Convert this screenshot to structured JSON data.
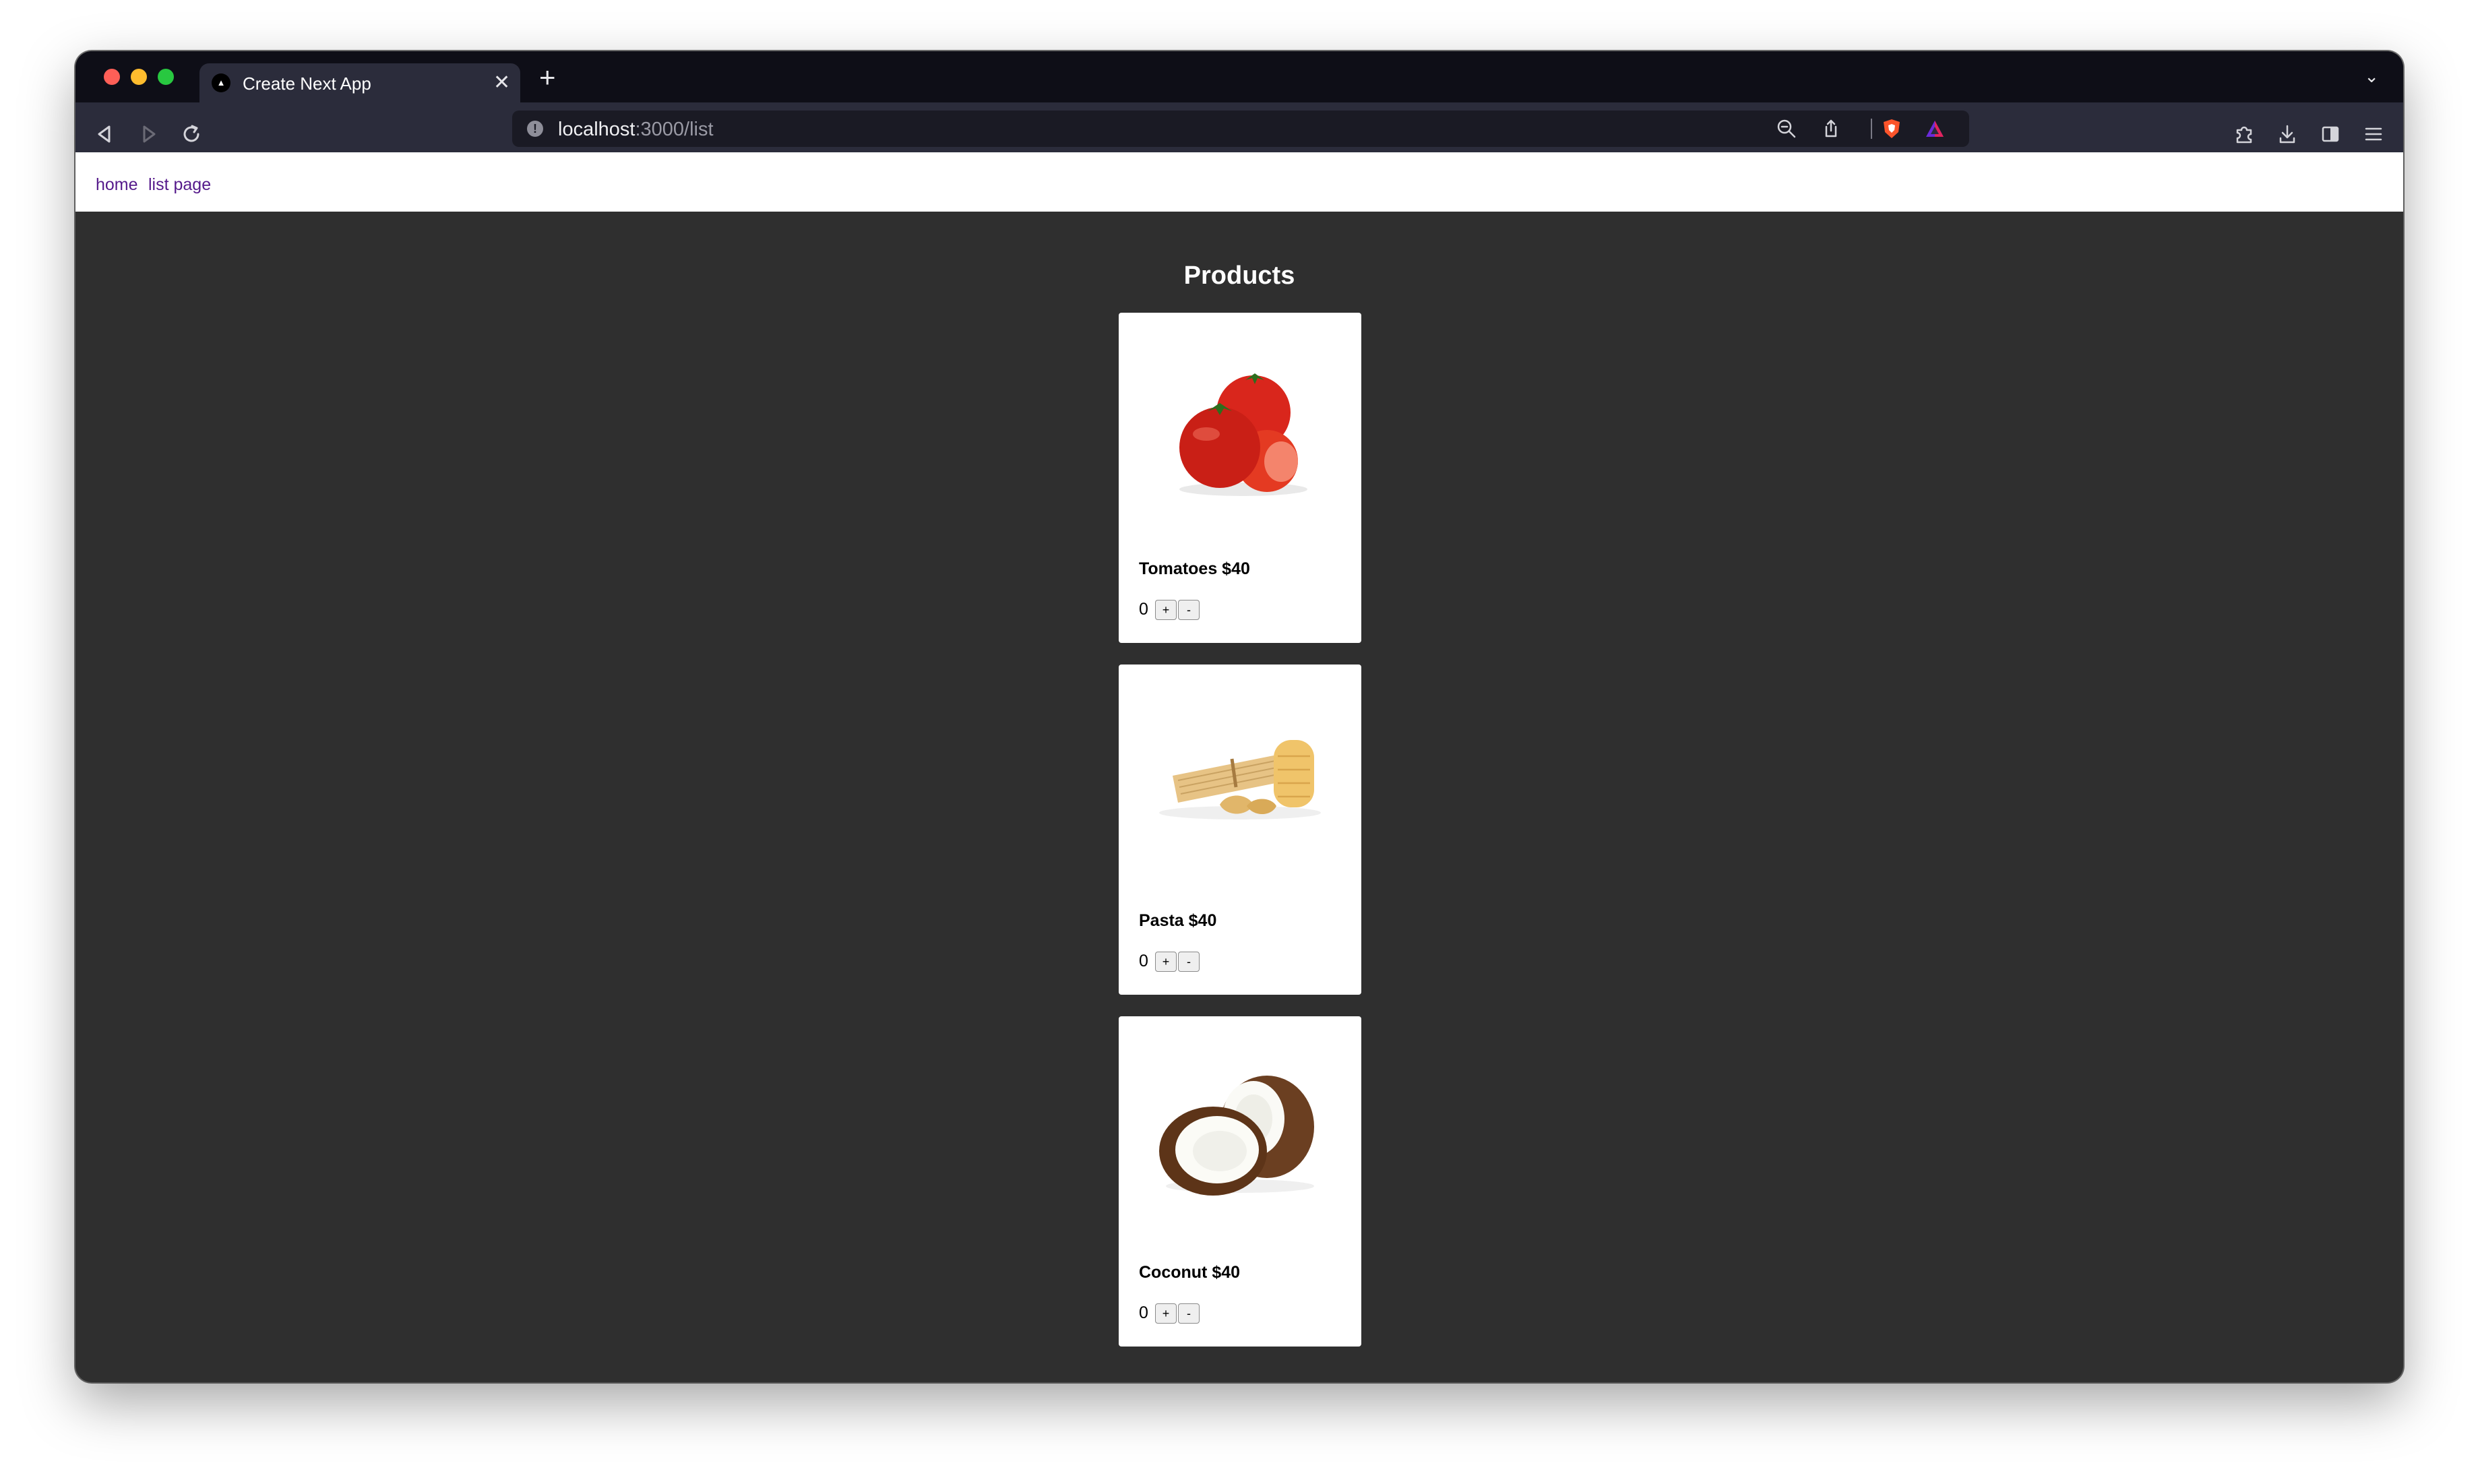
{
  "browser": {
    "tab": {
      "title": "Create Next App",
      "favicon": "next-logo-icon",
      "close": "✕"
    },
    "new_tab": "+",
    "tab_menu": "⌄",
    "url": {
      "host": "localhost",
      "path": ":3000/list"
    }
  },
  "nav": {
    "home": "home",
    "list_page": "list page"
  },
  "page": {
    "heading": "Products"
  },
  "products": [
    {
      "title": "Tomatoes $40",
      "quantity": "0",
      "plus": "+",
      "minus": "-",
      "image": "tomatoes"
    },
    {
      "title": "Pasta $40",
      "quantity": "0",
      "plus": "+",
      "minus": "-",
      "image": "pasta"
    },
    {
      "title": "Coconut $40",
      "quantity": "0",
      "plus": "+",
      "minus": "-",
      "image": "coconut"
    }
  ],
  "colors": {
    "page_background": "#2f2f2f",
    "titlebar": "#0e0e17",
    "toolbar": "#2b2c3b",
    "link": "#551a8b",
    "brave_shield": "#fb542b"
  }
}
